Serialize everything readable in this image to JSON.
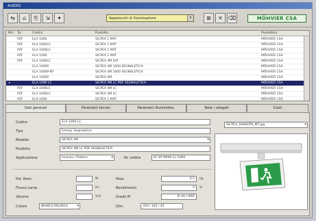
{
  "window": {
    "title": "ArtiDOC"
  },
  "toolbar": {
    "buttons": [
      "⇆",
      "⌂",
      "⎘",
      "⇲",
      "✦"
    ],
    "right_buttons": [
      "⊞",
      "✕",
      "⌫"
    ],
    "combo_value": "Apparecchi di illuminazione",
    "logo": "MÖHVIER CSA"
  },
  "grid": {
    "columns": [
      "Nm",
      "Tyr",
      "Codice",
      "Prodotto",
      "Produttore"
    ],
    "rows": [
      {
        "nm": "",
        "tyr": "PZF",
        "code": "ELA 1000",
        "product": "SICPEX 1 MAT",
        "maker": "MÖHVIER CSA",
        "selected": false
      },
      {
        "nm": "",
        "tyr": "PZF",
        "code": "ELA 1000LC",
        "product": "SICPEX 1 MAT",
        "maker": "MÖHVIER CSA",
        "selected": false
      },
      {
        "nm": "",
        "tyr": "PZF",
        "code": "ELA 1000LC",
        "product": "SICPEX 1 MAT",
        "maker": "MÖHVIER CSA",
        "selected": false
      },
      {
        "nm": "",
        "tyr": "PZF",
        "code": "ELA 1000",
        "product": "SICPEX 1 MAT",
        "maker": "MÖHVIER CSA",
        "selected": false
      },
      {
        "nm": "",
        "tyr": "PZF",
        "code": "ELA 1000LC",
        "product": "SICPEX 4M SAT",
        "maker": "MÖHVIER CSA",
        "selected": false
      },
      {
        "nm": "",
        "tyr": "",
        "code": "ELA 1000P",
        "product": "SICPEX 4M 1000 SEGNALETICA",
        "maker": "MÖHVIER CSA",
        "selected": false
      },
      {
        "nm": "",
        "tyr": "",
        "code": "ELA 1000P-NT",
        "product": "SICPEX 4M 1000 SEGNALETICA",
        "maker": "MÖHVIER CSA",
        "selected": false
      },
      {
        "nm": "",
        "tyr": "",
        "code": "ELA 1000P",
        "product": "SICPEX 4M",
        "maker": "MÖHVIER CSA",
        "selected": false
      },
      {
        "nm": "▸",
        "tyr": "",
        "code": "ELA 1000 LC",
        "product": "SICPEX 4M LC PDF SEGNALETICA",
        "maker": "MÖHVIER CSA",
        "selected": true
      },
      {
        "nm": "",
        "tyr": "PZF",
        "code": "ELA 1000LC",
        "product": "SICPEX 4M LC",
        "maker": "MÖHVIER CSA",
        "selected": false
      },
      {
        "nm": "",
        "tyr": "PZF",
        "code": "ELA 1000LC",
        "product": "SICPEX 4M LC",
        "maker": "MÖHVIER CSA",
        "selected": false
      },
      {
        "nm": "",
        "tyr": "PZF",
        "code": "ELA 1000",
        "product": "SICPEX 1 MAT",
        "maker": "MÖHVIER CSA",
        "selected": false
      }
    ]
  },
  "tabs": [
    "Dati generali",
    "Parametri tecnici",
    "Parametri illuminotec.",
    "Note / allegati",
    "Costi"
  ],
  "form": {
    "codice_label": "Codice",
    "codice": "ELA 1000 LC",
    "tipo_label": "Tipo",
    "tipo": "Emerg. Segnaletica",
    "modello_label": "Modello",
    "modello": "SICPEX 4M",
    "prodotto_label": "Prodotto",
    "prodotto": "SICPEX 4M LC PDF SEGNALETICA",
    "applicazione_label": "Applicazione",
    "applicazione": "Incasso / Plafone",
    "nr_label": "Nr. ordine",
    "nr": "EF 4P M000 LC E000",
    "selector": "SICPEX_SANGEPA_MT.jpg",
    "pot_label": "Pot. Nom.",
    "pot_unit": "W",
    "flux_label": "Flusso Lamp.",
    "flux_unit": "lm",
    "volt_label": "Volume",
    "volt_unit": "V/H",
    "colore_label": "Colore",
    "colore": "BIANCO RAL9010",
    "peso_label": "Peso",
    "peso": "0.5",
    "peso_unit": "kg",
    "rend_label": "Rendimento",
    "rend": "0",
    "rend_unit": "%",
    "ip_label": "Grado IP",
    "ip": "IP 40 / IP65",
    "dim_label": "Dim.",
    "dim": "350 / 165 / 45"
  }
}
